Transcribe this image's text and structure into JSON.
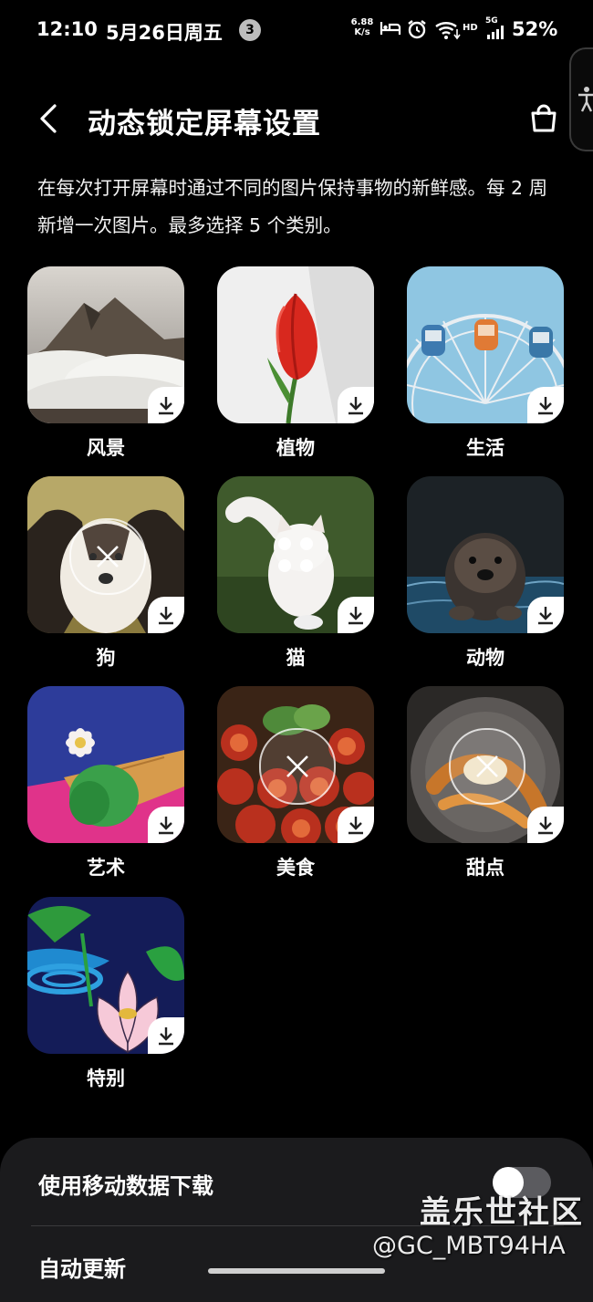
{
  "status_bar": {
    "time": "12:10",
    "date": "5月26日周五",
    "notification_count": "3",
    "net_speed_value": "6.88",
    "net_speed_unit": "K/s",
    "hd": "HD",
    "network": "5G",
    "battery": "52%"
  },
  "header": {
    "title": "动态锁定屏幕设置"
  },
  "description": "在每次打开屏幕时通过不同的图片保持事物的新鲜感。每 2 周新增一次图片。最多选择 5 个类别。",
  "categories": [
    {
      "label": "风景",
      "state": "downloadable"
    },
    {
      "label": "植物",
      "state": "downloadable"
    },
    {
      "label": "生活",
      "state": "downloadable"
    },
    {
      "label": "狗",
      "state": "selected"
    },
    {
      "label": "猫",
      "state": "loading"
    },
    {
      "label": "动物",
      "state": "downloadable"
    },
    {
      "label": "艺术",
      "state": "downloadable"
    },
    {
      "label": "美食",
      "state": "selected"
    },
    {
      "label": "甜点",
      "state": "selected"
    },
    {
      "label": "特别",
      "state": "downloadable"
    }
  ],
  "settings": {
    "mobile_data_label": "使用移动数据下载",
    "mobile_data_enabled": false,
    "auto_update_label": "自动更新"
  },
  "watermark": {
    "brand": "盖乐世社区",
    "user": "@GC_MBT94HA"
  },
  "icons": [
    "back-arrow-icon",
    "shopping-bag-icon",
    "accessibility-icon",
    "download-icon",
    "deselect-x-icon",
    "loading-dots-icon",
    "wifi-icon",
    "alarm-icon",
    "bed-icon",
    "signal-icon"
  ],
  "colors": {
    "background": "#000000",
    "sheet": "#1b1b1d",
    "toggle_off": "#5b5b5f"
  }
}
